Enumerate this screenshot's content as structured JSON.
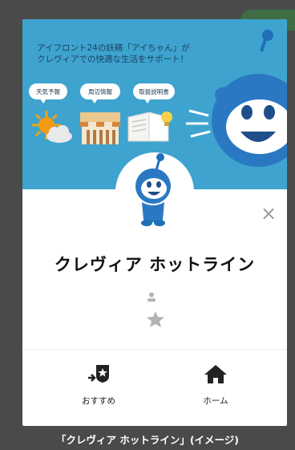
{
  "banner": {
    "headline_line1": "アイフロント24の妖精「アイちゃん」が",
    "headline_line2": "クレヴィアでの快適な生活をサポート！",
    "bubbles": [
      "天気予報",
      "周辺情報",
      "取扱説明書"
    ],
    "color": "#3ea3cf"
  },
  "profile": {
    "name": "クレヴィア ホットライン"
  },
  "close": {
    "label": "×"
  },
  "nav": {
    "recommend_label": "おすすめ",
    "home_label": "ホーム"
  },
  "caption": "「クレヴィア ホットライン」(イメージ)",
  "icons": {
    "avatar": "mascot-icon",
    "weather": "weather-icon",
    "shop": "shop-icon",
    "manual": "manual-book-icon",
    "person": "person-icon",
    "star": "star-icon",
    "recommend": "recommend-icon",
    "home": "home-icon",
    "close": "close-icon"
  },
  "colors": {
    "mascot_blue": "#1f6fb8",
    "background": "#4a4a4a",
    "icon_gray": "#b3b3b3"
  }
}
